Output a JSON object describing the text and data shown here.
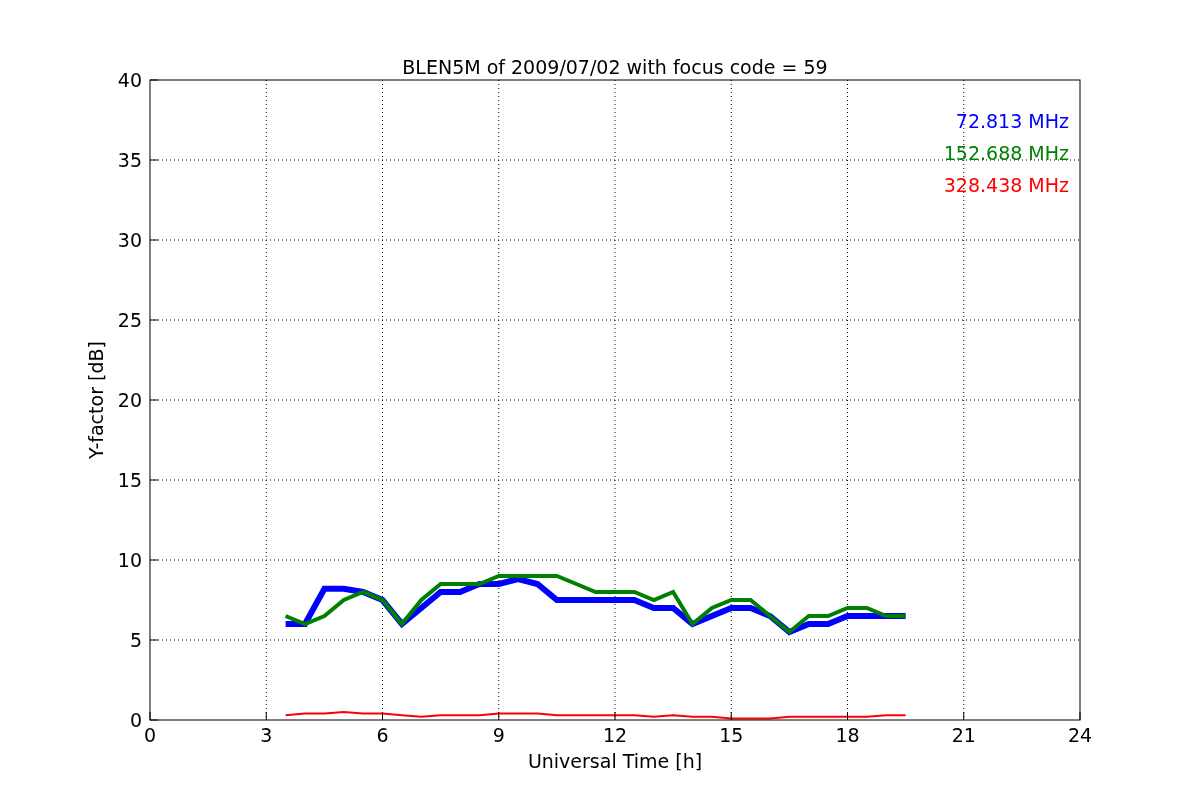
{
  "figure": {
    "chart_data": {
      "type": "line",
      "title": "BLEN5M of 2009/07/02 with focus code = 59",
      "xlabel": "Universal Time [h]",
      "ylabel": "Y-factor [dB]",
      "x": [
        3.5,
        4,
        4.5,
        5,
        5.5,
        6,
        6.5,
        7,
        7.5,
        8,
        8.5,
        9,
        9.5,
        10,
        10.5,
        11,
        11.5,
        12,
        12.5,
        13,
        13.5,
        14,
        14.5,
        15,
        15.5,
        16,
        16.5,
        17,
        17.5,
        18,
        18.5,
        19,
        19.5
      ],
      "series": [
        {
          "name": "72.813 MHz",
          "color": "#0000ff",
          "values": [
            6,
            6,
            8.2,
            8.2,
            8,
            7.5,
            6,
            7,
            8,
            8,
            8.5,
            8.5,
            8.8,
            8.5,
            7.5,
            7.5,
            7.5,
            7.5,
            7.5,
            7,
            7,
            6,
            6.5,
            7,
            7,
            6.5,
            5.5,
            6,
            6,
            6.5,
            6.5,
            6.5,
            6.5
          ]
        },
        {
          "name": "152.688 MHz",
          "color": "#008000",
          "values": [
            6.5,
            6,
            6.5,
            7.5,
            8,
            7.5,
            6,
            7.5,
            8.5,
            8.5,
            8.5,
            9,
            9,
            9,
            9,
            8.5,
            8,
            8,
            8,
            7.5,
            8,
            6,
            7,
            7.5,
            7.5,
            6.5,
            5.5,
            6.5,
            6.5,
            7,
            7,
            6.5,
            6.5
          ]
        },
        {
          "name": "328.438 MHz",
          "color": "#ff0000",
          "values": [
            0.3,
            0.4,
            0.4,
            0.5,
            0.4,
            0.4,
            0.3,
            0.2,
            0.3,
            0.3,
            0.3,
            0.4,
            0.4,
            0.4,
            0.3,
            0.3,
            0.3,
            0.3,
            0.3,
            0.2,
            0.3,
            0.2,
            0.2,
            0.1,
            0.1,
            0.1,
            0.2,
            0.2,
            0.2,
            0.2,
            0.2,
            0.3,
            0.3
          ]
        }
      ],
      "xlim": [
        0,
        24
      ],
      "ylim": [
        0,
        40
      ],
      "xticks": [
        0,
        3,
        6,
        9,
        12,
        15,
        18,
        21,
        24
      ],
      "yticks": [
        0,
        5,
        10,
        15,
        20,
        25,
        30,
        35,
        40
      ],
      "grid": true
    }
  }
}
